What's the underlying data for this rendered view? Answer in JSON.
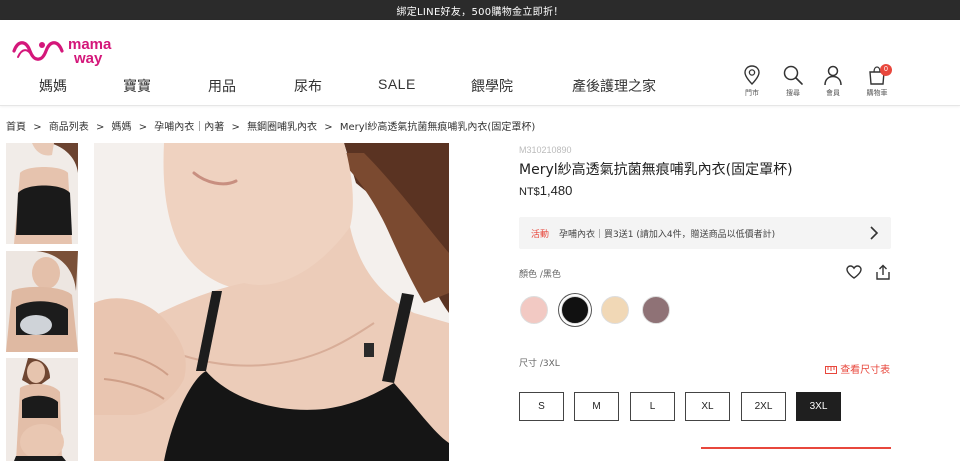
{
  "announcement": "綁定LINE好友，500購物金立即折！",
  "brand": {
    "line1": "mama",
    "line2": "way",
    "color": "#d4177a"
  },
  "nav": [
    "媽媽",
    "寶寶",
    "用品",
    "尿布",
    "SALE",
    "餵學院",
    "產後護理之家"
  ],
  "utilities": {
    "store": {
      "label": "門市",
      "icon": "location-pin-icon"
    },
    "search": {
      "label": "搜尋",
      "icon": "search-icon"
    },
    "member": {
      "label": "會員",
      "icon": "user-icon"
    },
    "cart": {
      "label": "購物車",
      "icon": "shopping-bag-icon",
      "count": "0"
    }
  },
  "breadcrumb": [
    "首頁",
    ">",
    "商品列表",
    ">",
    "媽媽",
    ">",
    "孕哺內衣｜內著",
    ">",
    "無鋼圈哺乳內衣",
    ">",
    "Meryl紗高透氣抗菌無痕哺乳內衣(固定罩杯)"
  ],
  "product": {
    "sku": "M310210890",
    "title": "Meryl紗高透氣抗菌無痕哺乳內衣(固定罩杯)",
    "currency": "NT$",
    "price": "1,480",
    "promo_tag": "活動",
    "promo_text": "孕哺內衣｜買3送1 (請加入4件，贈送商品以低價者計)",
    "color_label": "顏色 /黑色",
    "size_label": "尺寸 /3XL",
    "size_chart": "查看尺寸表",
    "colors": [
      "#f2c9c3",
      "#111111",
      "#f1d8b6",
      "#8f7276"
    ],
    "selected_color": 1,
    "sizes": [
      "S",
      "M",
      "L",
      "XL",
      "2XL",
      "3XL"
    ],
    "selected_size": 5
  },
  "accent": "#e8473c"
}
